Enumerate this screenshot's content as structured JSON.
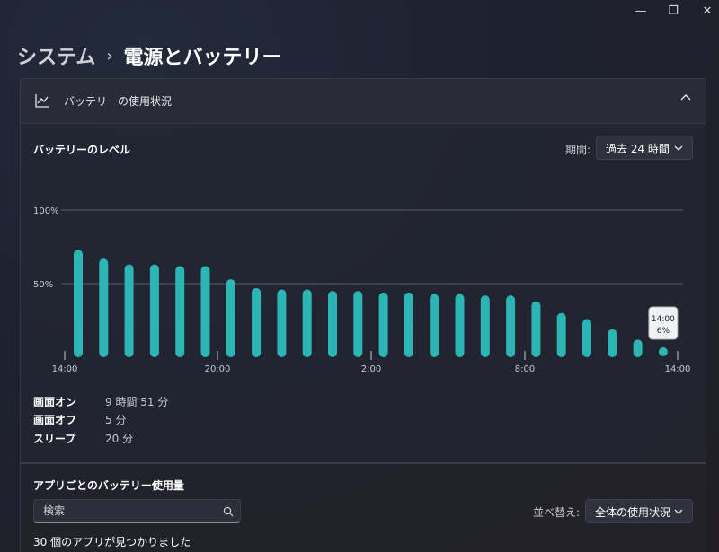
{
  "window": {
    "minimize_glyph": "—",
    "restore_glyph": "❐",
    "close_glyph": "✕"
  },
  "breadcrumb": {
    "parent": "システム",
    "separator": "›",
    "current": "電源とバッテリー"
  },
  "usage_section": {
    "title": "バッテリーの使用状況",
    "icon": "line-chart-icon",
    "expander_icon": "chevron-up-icon"
  },
  "battery_level": {
    "title": "バッテリーのレベル",
    "period_label": "期間:",
    "period_value": "過去 24 時間"
  },
  "chart_data": {
    "type": "bar",
    "ylabels": [
      "100%",
      "50%"
    ],
    "ylim": [
      0,
      100
    ],
    "xlabels": [
      "14:00",
      "20:00",
      "2:00",
      "8:00",
      "14:00"
    ],
    "values": [
      73,
      67,
      63,
      63,
      62,
      62,
      53,
      47,
      46,
      46,
      45,
      45,
      44,
      44,
      43,
      43,
      42,
      42,
      38,
      30,
      26,
      19,
      12,
      6
    ],
    "tooltip": {
      "time": "14:00",
      "value": "6%"
    },
    "bar_color": "#2bb5b4",
    "grid": true
  },
  "stats": [
    {
      "label": "画面オン",
      "value": "9 時間 51 分"
    },
    {
      "label": "画面オフ",
      "value": "5 分"
    },
    {
      "label": "スリープ",
      "value": "20 分"
    }
  ],
  "apps": {
    "title": "アプリごとのバッテリー使用量",
    "search_placeholder": "検索",
    "sort_label": "並べ替え:",
    "sort_value": "全体の使用状況",
    "count_text": "30 個のアプリが見つかりました"
  }
}
